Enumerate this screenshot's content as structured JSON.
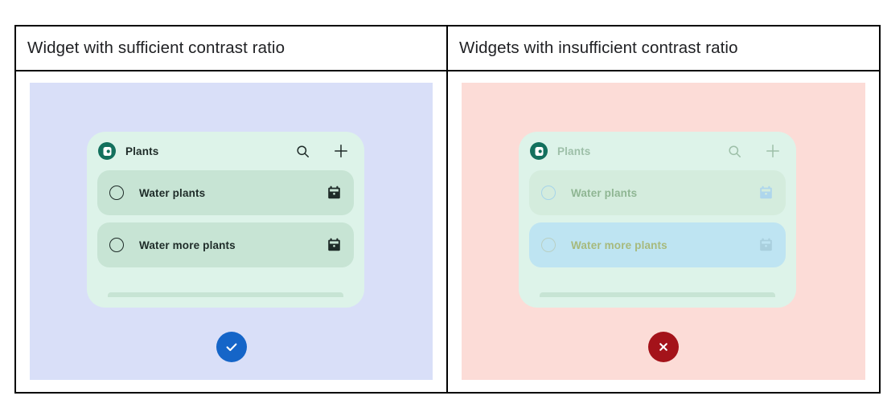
{
  "table": {
    "columns": [
      {
        "id": "sufficient",
        "header": "Widget with sufficient contrast ratio",
        "panel_color": "#d9dff8",
        "verdict": {
          "icon": "check-icon",
          "label": "Pass",
          "color": "#1565c8"
        },
        "widget": {
          "card_color": "#ddf3e9",
          "app_icon": "tasks-app-icon",
          "title": "Plants",
          "actions": [
            {
              "icon": "search-icon",
              "label": "Search"
            },
            {
              "icon": "plus-icon",
              "label": "Add task"
            }
          ],
          "tasks": [
            {
              "label": "Water plants",
              "checkbox": "unchecked-circle-icon",
              "trailing_icon": "calendar-icon",
              "row_color": "#c7e4d4",
              "text_color": "#1e2b28"
            },
            {
              "label": "Water more plants",
              "checkbox": "unchecked-circle-icon",
              "trailing_icon": "calendar-icon",
              "row_color": "#c7e4d4",
              "text_color": "#1e2b28"
            }
          ]
        }
      },
      {
        "id": "insufficient",
        "header": "Widgets with insufficient contrast ratio",
        "panel_color": "#fcdcd7",
        "verdict": {
          "icon": "close-icon",
          "label": "Fail",
          "color": "#a4131a"
        },
        "widget": {
          "card_color": "#ddf3e9",
          "app_icon": "tasks-app-icon",
          "title": "Plants",
          "actions": [
            {
              "icon": "search-icon",
              "label": "Search"
            },
            {
              "icon": "plus-icon",
              "label": "Add task"
            }
          ],
          "tasks": [
            {
              "label": "Water plants",
              "checkbox": "unchecked-circle-icon",
              "trailing_icon": "calendar-icon",
              "row_color": "#d4ecdd",
              "text_color": "#8fb693"
            },
            {
              "label": "Water more plants",
              "checkbox": "unchecked-circle-icon",
              "trailing_icon": "calendar-icon",
              "row_color": "#bee4f2",
              "text_color": "#a7b97c"
            }
          ]
        }
      }
    ]
  }
}
